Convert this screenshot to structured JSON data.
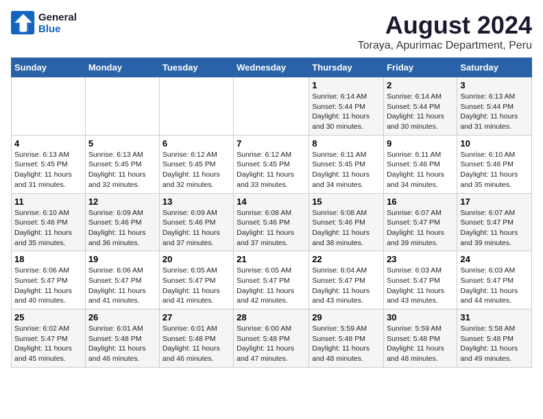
{
  "logo": {
    "line1": "General",
    "line2": "Blue"
  },
  "title": "August 2024",
  "subtitle": "Toraya, Apurimac Department, Peru",
  "weekdays": [
    "Sunday",
    "Monday",
    "Tuesday",
    "Wednesday",
    "Thursday",
    "Friday",
    "Saturday"
  ],
  "weeks": [
    [
      {
        "day": "",
        "sunrise": "",
        "sunset": "",
        "daylight": ""
      },
      {
        "day": "",
        "sunrise": "",
        "sunset": "",
        "daylight": ""
      },
      {
        "day": "",
        "sunrise": "",
        "sunset": "",
        "daylight": ""
      },
      {
        "day": "",
        "sunrise": "",
        "sunset": "",
        "daylight": ""
      },
      {
        "day": "1",
        "sunrise": "Sunrise: 6:14 AM",
        "sunset": "Sunset: 5:44 PM",
        "daylight": "Daylight: 11 hours and 30 minutes."
      },
      {
        "day": "2",
        "sunrise": "Sunrise: 6:14 AM",
        "sunset": "Sunset: 5:44 PM",
        "daylight": "Daylight: 11 hours and 30 minutes."
      },
      {
        "day": "3",
        "sunrise": "Sunrise: 6:13 AM",
        "sunset": "Sunset: 5:44 PM",
        "daylight": "Daylight: 11 hours and 31 minutes."
      }
    ],
    [
      {
        "day": "4",
        "sunrise": "Sunrise: 6:13 AM",
        "sunset": "Sunset: 5:45 PM",
        "daylight": "Daylight: 11 hours and 31 minutes."
      },
      {
        "day": "5",
        "sunrise": "Sunrise: 6:13 AM",
        "sunset": "Sunset: 5:45 PM",
        "daylight": "Daylight: 11 hours and 32 minutes."
      },
      {
        "day": "6",
        "sunrise": "Sunrise: 6:12 AM",
        "sunset": "Sunset: 5:45 PM",
        "daylight": "Daylight: 11 hours and 32 minutes."
      },
      {
        "day": "7",
        "sunrise": "Sunrise: 6:12 AM",
        "sunset": "Sunset: 5:45 PM",
        "daylight": "Daylight: 11 hours and 33 minutes."
      },
      {
        "day": "8",
        "sunrise": "Sunrise: 6:11 AM",
        "sunset": "Sunset: 5:45 PM",
        "daylight": "Daylight: 11 hours and 34 minutes."
      },
      {
        "day": "9",
        "sunrise": "Sunrise: 6:11 AM",
        "sunset": "Sunset: 5:46 PM",
        "daylight": "Daylight: 11 hours and 34 minutes."
      },
      {
        "day": "10",
        "sunrise": "Sunrise: 6:10 AM",
        "sunset": "Sunset: 5:46 PM",
        "daylight": "Daylight: 11 hours and 35 minutes."
      }
    ],
    [
      {
        "day": "11",
        "sunrise": "Sunrise: 6:10 AM",
        "sunset": "Sunset: 5:46 PM",
        "daylight": "Daylight: 11 hours and 35 minutes."
      },
      {
        "day": "12",
        "sunrise": "Sunrise: 6:09 AM",
        "sunset": "Sunset: 5:46 PM",
        "daylight": "Daylight: 11 hours and 36 minutes."
      },
      {
        "day": "13",
        "sunrise": "Sunrise: 6:09 AM",
        "sunset": "Sunset: 5:46 PM",
        "daylight": "Daylight: 11 hours and 37 minutes."
      },
      {
        "day": "14",
        "sunrise": "Sunrise: 6:08 AM",
        "sunset": "Sunset: 5:46 PM",
        "daylight": "Daylight: 11 hours and 37 minutes."
      },
      {
        "day": "15",
        "sunrise": "Sunrise: 6:08 AM",
        "sunset": "Sunset: 5:46 PM",
        "daylight": "Daylight: 11 hours and 38 minutes."
      },
      {
        "day": "16",
        "sunrise": "Sunrise: 6:07 AM",
        "sunset": "Sunset: 5:47 PM",
        "daylight": "Daylight: 11 hours and 39 minutes."
      },
      {
        "day": "17",
        "sunrise": "Sunrise: 6:07 AM",
        "sunset": "Sunset: 5:47 PM",
        "daylight": "Daylight: 11 hours and 39 minutes."
      }
    ],
    [
      {
        "day": "18",
        "sunrise": "Sunrise: 6:06 AM",
        "sunset": "Sunset: 5:47 PM",
        "daylight": "Daylight: 11 hours and 40 minutes."
      },
      {
        "day": "19",
        "sunrise": "Sunrise: 6:06 AM",
        "sunset": "Sunset: 5:47 PM",
        "daylight": "Daylight: 11 hours and 41 minutes."
      },
      {
        "day": "20",
        "sunrise": "Sunrise: 6:05 AM",
        "sunset": "Sunset: 5:47 PM",
        "daylight": "Daylight: 11 hours and 41 minutes."
      },
      {
        "day": "21",
        "sunrise": "Sunrise: 6:05 AM",
        "sunset": "Sunset: 5:47 PM",
        "daylight": "Daylight: 11 hours and 42 minutes."
      },
      {
        "day": "22",
        "sunrise": "Sunrise: 6:04 AM",
        "sunset": "Sunset: 5:47 PM",
        "daylight": "Daylight: 11 hours and 43 minutes."
      },
      {
        "day": "23",
        "sunrise": "Sunrise: 6:03 AM",
        "sunset": "Sunset: 5:47 PM",
        "daylight": "Daylight: 11 hours and 43 minutes."
      },
      {
        "day": "24",
        "sunrise": "Sunrise: 6:03 AM",
        "sunset": "Sunset: 5:47 PM",
        "daylight": "Daylight: 11 hours and 44 minutes."
      }
    ],
    [
      {
        "day": "25",
        "sunrise": "Sunrise: 6:02 AM",
        "sunset": "Sunset: 5:47 PM",
        "daylight": "Daylight: 11 hours and 45 minutes."
      },
      {
        "day": "26",
        "sunrise": "Sunrise: 6:01 AM",
        "sunset": "Sunset: 5:48 PM",
        "daylight": "Daylight: 11 hours and 46 minutes."
      },
      {
        "day": "27",
        "sunrise": "Sunrise: 6:01 AM",
        "sunset": "Sunset: 5:48 PM",
        "daylight": "Daylight: 11 hours and 46 minutes."
      },
      {
        "day": "28",
        "sunrise": "Sunrise: 6:00 AM",
        "sunset": "Sunset: 5:48 PM",
        "daylight": "Daylight: 11 hours and 47 minutes."
      },
      {
        "day": "29",
        "sunrise": "Sunrise: 5:59 AM",
        "sunset": "Sunset: 5:48 PM",
        "daylight": "Daylight: 11 hours and 48 minutes."
      },
      {
        "day": "30",
        "sunrise": "Sunrise: 5:59 AM",
        "sunset": "Sunset: 5:48 PM",
        "daylight": "Daylight: 11 hours and 48 minutes."
      },
      {
        "day": "31",
        "sunrise": "Sunrise: 5:58 AM",
        "sunset": "Sunset: 5:48 PM",
        "daylight": "Daylight: 11 hours and 49 minutes."
      }
    ]
  ]
}
